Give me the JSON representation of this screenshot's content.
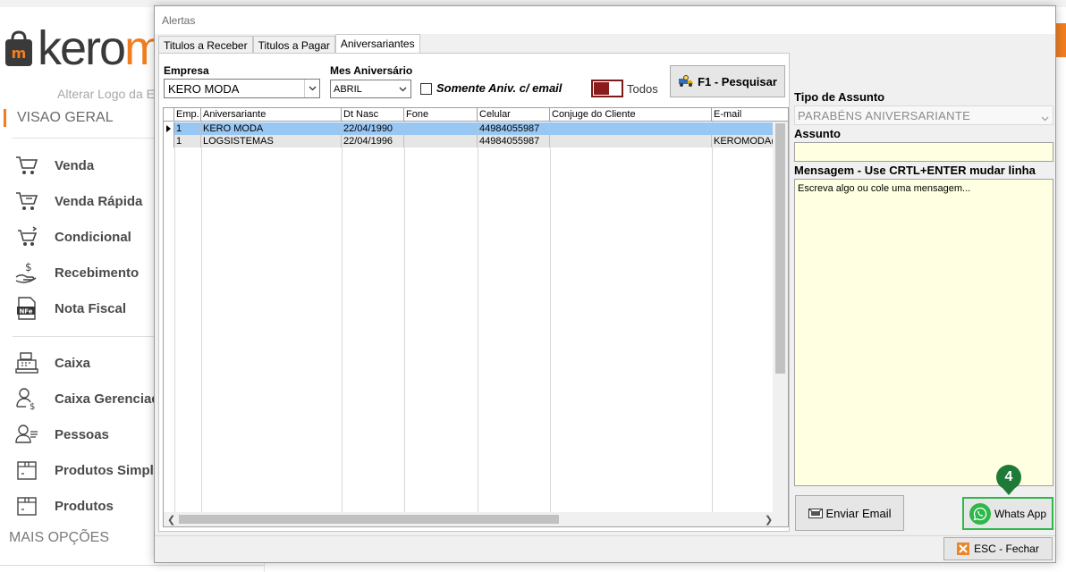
{
  "background": {
    "logo_text": "kero",
    "logo_accent": "m",
    "alter_logo": "Alterar Logo da E",
    "section_overview": "VISAO GERAL",
    "more_options": "MAIS OPÇÕES",
    "menu": [
      {
        "label": "Venda",
        "icon": "cart-icon"
      },
      {
        "label": "Venda Rápida",
        "icon": "cart-fast-icon"
      },
      {
        "label": "Condicional",
        "icon": "cart-exchange-icon"
      },
      {
        "label": "Recebimento",
        "icon": "money-hand-icon"
      },
      {
        "label": "Nota Fiscal",
        "icon": "nfe-icon"
      },
      {
        "label": "Caixa",
        "icon": "cash-register-icon"
      },
      {
        "label": "Caixa Gerenciad",
        "icon": "user-money-icon"
      },
      {
        "label": "Pessoas",
        "icon": "people-icon"
      },
      {
        "label": "Produtos Simple",
        "icon": "box-icon"
      },
      {
        "label": "Produtos",
        "icon": "box-icon"
      }
    ],
    "colors": {
      "accent": "#f07d20"
    }
  },
  "dialog": {
    "title": "Alertas",
    "tabs": [
      "Titulos a Receber",
      "Titulos a Pagar",
      "Aniversariantes"
    ],
    "active_tab": "Aniversariantes",
    "filters": {
      "empresa_label": "Empresa",
      "empresa_value": "KERO MODA",
      "mes_label": "Mes Aniversário",
      "mes_value": "ABRIL",
      "somente_label": "Somente Aniv. c/ email",
      "todos_label": "Todos",
      "search_button": "F1 - Pesquisar"
    },
    "grid": {
      "columns": [
        "Emp.",
        "Aniversariante",
        "Dt Nasc",
        "Fone",
        "Celular",
        "Conjuge do Cliente",
        "E-mail"
      ],
      "rows": [
        {
          "emp": "1",
          "nome": "KERO MODA",
          "dt": "22/04/1990",
          "fone": "",
          "cel": "44984055987",
          "conj": "",
          "email": ""
        },
        {
          "emp": "1",
          "nome": "LOGSISTEMAS",
          "dt": "22/04/1996",
          "fone": "",
          "cel": "44984055987",
          "conj": "",
          "email": "KEROMODA@L"
        }
      ]
    },
    "right": {
      "tipo_label": "Tipo de Assunto",
      "tipo_value": "PARABÉNS ANIVERSARIANTE",
      "assunto_label": "Assunto",
      "assunto_value": "",
      "mensagem_label": "Mensagem - Use CRTL+ENTER mudar linha",
      "mensagem_placeholder": "Escreva algo ou cole uma mensagem...",
      "email_button": "Enviar Email",
      "whatsapp_button": "Whats App",
      "badge": "4"
    },
    "close_button": "ESC - Fechar",
    "colors": {
      "selected_row": "#99c7f3",
      "whatsapp": "#2db84a",
      "badge": "#1f7a37",
      "toggle": "#8a1c1c"
    }
  }
}
